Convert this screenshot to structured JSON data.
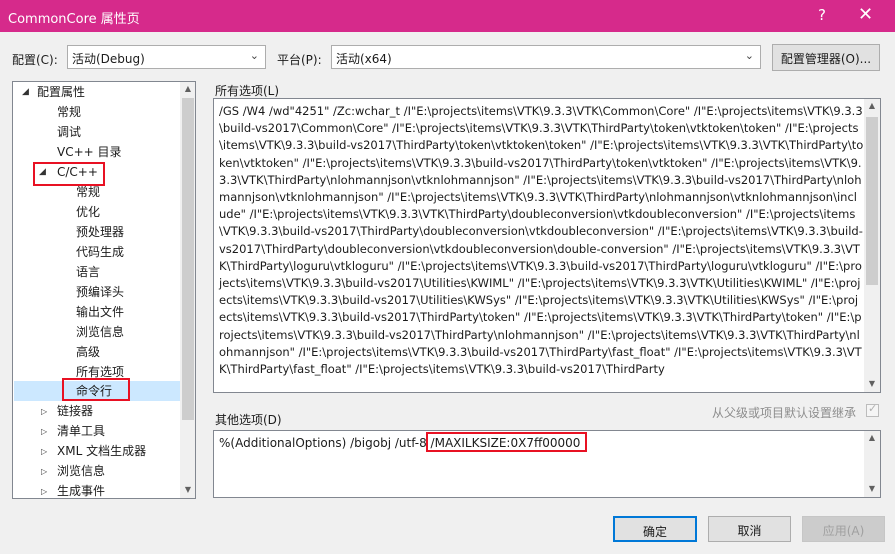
{
  "window": {
    "title": "CommonCore 属性页",
    "help": "?",
    "close": "✕"
  },
  "config": {
    "label": "配置(C):",
    "value": "活动(Debug)"
  },
  "platform": {
    "label": "平台(P):",
    "value": "活动(x64)"
  },
  "config_manager_label": "配置管理器(O)...",
  "tree": {
    "root": "配置属性",
    "items": [
      "常规",
      "调试",
      "VC++ 目录"
    ],
    "cpp": "C/C++",
    "cpp_children": [
      "常规",
      "优化",
      "预处理器",
      "代码生成",
      "语言",
      "预编译头",
      "输出文件",
      "浏览信息",
      "高级",
      "所有选项",
      "命令行"
    ],
    "after": [
      "链接器",
      "清单工具",
      "XML 文档生成器",
      "浏览信息",
      "生成事件"
    ]
  },
  "all_options": {
    "label": "所有选项(L)",
    "text": "/GS /W4 /wd\"4251\" /Zc:wchar_t /I\"E:\\projects\\items\\VTK\\9.3.3\\VTK\\Common\\Core\" /I\"E:\\projects\\items\\VTK\\9.3.3\\build-vs2017\\Common\\Core\" /I\"E:\\projects\\items\\VTK\\9.3.3\\VTK\\ThirdParty\\token\\vtktoken\\token\" /I\"E:\\projects\\items\\VTK\\9.3.3\\build-vs2017\\ThirdParty\\token\\vtktoken\\token\" /I\"E:\\projects\\items\\VTK\\9.3.3\\VTK\\ThirdParty\\token\\vtktoken\" /I\"E:\\projects\\items\\VTK\\9.3.3\\build-vs2017\\ThirdParty\\token\\vtktoken\" /I\"E:\\projects\\items\\VTK\\9.3.3\\VTK\\ThirdParty\\nlohmannjson\\vtknlohmannjson\" /I\"E:\\projects\\items\\VTK\\9.3.3\\build-vs2017\\ThirdParty\\nlohmannjson\\vtknlohmannjson\" /I\"E:\\projects\\items\\VTK\\9.3.3\\VTK\\ThirdParty\\nlohmannjson\\vtknlohmannjson\\include\" /I\"E:\\projects\\items\\VTK\\9.3.3\\VTK\\ThirdParty\\doubleconversion\\vtkdoubleconversion\" /I\"E:\\projects\\items\\VTK\\9.3.3\\build-vs2017\\ThirdParty\\doubleconversion\\vtkdoubleconversion\" /I\"E:\\projects\\items\\VTK\\9.3.3\\build-vs2017\\ThirdParty\\doubleconversion\\vtkdoubleconversion\\double-conversion\" /I\"E:\\projects\\items\\VTK\\9.3.3\\VTK\\ThirdParty\\loguru\\vtkloguru\" /I\"E:\\projects\\items\\VTK\\9.3.3\\build-vs2017\\ThirdParty\\loguru\\vtkloguru\" /I\"E:\\projects\\items\\VTK\\9.3.3\\build-vs2017\\Utilities\\KWIML\" /I\"E:\\projects\\items\\VTK\\9.3.3\\VTK\\Utilities\\KWIML\" /I\"E:\\projects\\items\\VTK\\9.3.3\\build-vs2017\\Utilities\\KWSys\" /I\"E:\\projects\\items\\VTK\\9.3.3\\VTK\\Utilities\\KWSys\" /I\"E:\\projects\\items\\VTK\\9.3.3\\build-vs2017\\ThirdParty\\token\" /I\"E:\\projects\\items\\VTK\\9.3.3\\VTK\\ThirdParty\\token\" /I\"E:\\projects\\items\\VTK\\9.3.3\\build-vs2017\\ThirdParty\\nlohmannjson\" /I\"E:\\projects\\items\\VTK\\9.3.3\\VTK\\ThirdParty\\nlohmannjson\" /I\"E:\\projects\\items\\VTK\\9.3.3\\build-vs2017\\ThirdParty\\fast_float\" /I\"E:\\projects\\items\\VTK\\9.3.3\\VTK\\ThirdParty\\fast_float\" /I\"E:\\projects\\items\\VTK\\9.3.3\\build-vs2017\\ThirdParty"
  },
  "inherit_label": "从父级或项目默认设置继承",
  "other_options": {
    "label": "其他选项(D)",
    "prefix": "%(AdditionalOptions) /bigobj /utf-8 ",
    "highlight": "/MAXILKSIZE:0X7ff00000"
  },
  "buttons": {
    "ok": "确定",
    "cancel": "取消",
    "apply": "应用(A)"
  },
  "colors": {
    "titlebar": "#d62a8b",
    "highlight_box": "#e81123",
    "selection": "#cce8ff"
  }
}
